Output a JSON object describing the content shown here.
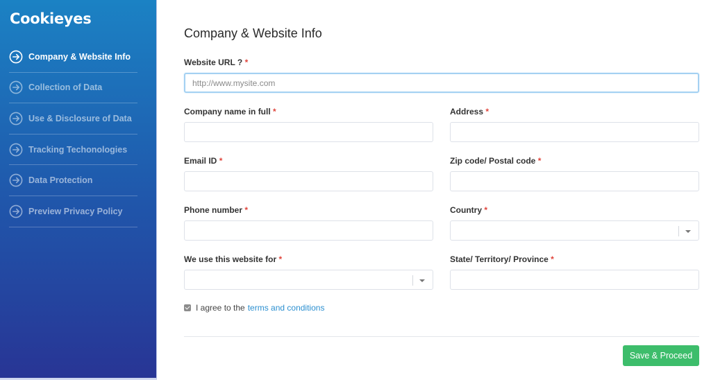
{
  "brand": {
    "logo_text": "Cookieyes"
  },
  "sidebar": {
    "items": [
      {
        "label": "Company & Website Info",
        "icon": "arrow-circle-right-icon",
        "active": true
      },
      {
        "label": "Collection of Data",
        "icon": "arrow-circle-right-icon",
        "active": false
      },
      {
        "label": "Use & Disclosure of Data",
        "icon": "arrow-circle-right-icon",
        "active": false
      },
      {
        "label": "Tracking Techonologies",
        "icon": "arrow-circle-right-icon",
        "active": false
      },
      {
        "label": "Data Protection",
        "icon": "arrow-circle-right-icon",
        "active": false
      },
      {
        "label": "Preview Privacy Policy",
        "icon": "arrow-circle-right-icon",
        "active": false
      }
    ]
  },
  "form": {
    "title": "Company & Website Info",
    "required_mark": "*",
    "website_url": {
      "label": "Website URL ?",
      "value": "",
      "placeholder": "http://www.mysite.com"
    },
    "company_name": {
      "label": "Company name in full",
      "value": ""
    },
    "address": {
      "label": "Address",
      "value": ""
    },
    "email": {
      "label": "Email ID",
      "value": ""
    },
    "zip": {
      "label": "Zip code/ Postal code",
      "value": ""
    },
    "phone": {
      "label": "Phone number",
      "value": ""
    },
    "country": {
      "label": "Country",
      "selected": ""
    },
    "website_use": {
      "label": "We use this website for",
      "selected": ""
    },
    "state": {
      "label": "State/ Territory/ Province",
      "value": ""
    },
    "agree": {
      "checked": true,
      "text": "I agree to the",
      "link_text": "terms and conditions"
    },
    "submit_label": "Save & Proceed"
  },
  "colors": {
    "sidebar_top": "#1b82c4",
    "sidebar_bottom": "#283595",
    "required": "#e0453c",
    "link": "#2b8fd0",
    "primary_button": "#3dbd6b",
    "focus_border": "#a4d1f2"
  }
}
